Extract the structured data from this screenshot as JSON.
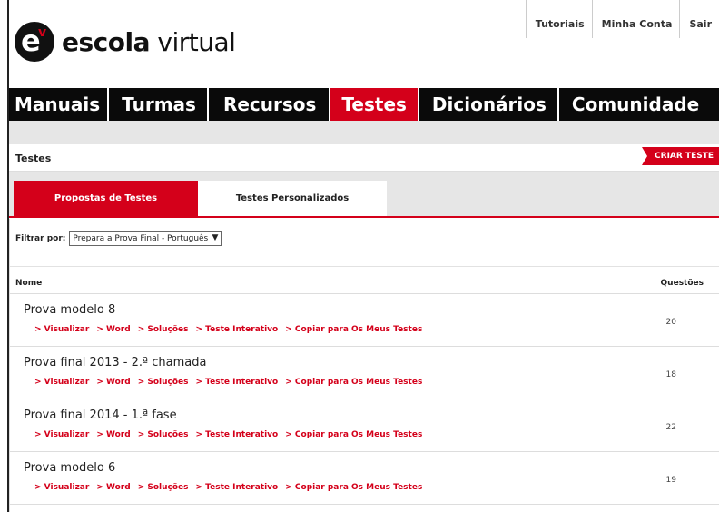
{
  "brand": {
    "logo_text_bold": "escola",
    "logo_text_light": " virtual",
    "badge_letter": "e",
    "badge_mark": "v"
  },
  "toplinks": [
    "Tutoriais",
    "Minha Conta",
    "Sair"
  ],
  "nav": {
    "items": [
      {
        "label": "Manuais",
        "active": false
      },
      {
        "label": "Turmas",
        "active": false
      },
      {
        "label": "Recursos",
        "active": false
      },
      {
        "label": "Testes",
        "active": true
      },
      {
        "label": "Dicionários",
        "active": false
      },
      {
        "label": "Comunidade",
        "active": false
      }
    ]
  },
  "page": {
    "title": "Testes",
    "create_button": "CRIAR TESTE"
  },
  "tabs": [
    {
      "label": "Propostas de Testes",
      "active": true
    },
    {
      "label": "Testes Personalizados",
      "active": false
    }
  ],
  "filter": {
    "label": "Filtrar por:",
    "selected": "Prepara a Prova Final - Português",
    "caret": "▼"
  },
  "table": {
    "headers": {
      "name": "Nome",
      "questions": "Questões"
    },
    "link_labels": [
      "> Visualizar",
      "> Word",
      "> Soluções",
      "> Teste Interativo",
      "> Copiar para Os Meus Testes"
    ],
    "rows": [
      {
        "name": "Prova modelo 8",
        "questions": "20"
      },
      {
        "name": "Prova final 2013 - 2.ª chamada",
        "questions": "18"
      },
      {
        "name": "Prova final 2014 - 1.ª fase",
        "questions": "22"
      },
      {
        "name": "Prova modelo 6",
        "questions": "19"
      }
    ]
  },
  "colors": {
    "accent": "#d4001a",
    "nav_bg": "#0a0a0a",
    "strip": "#e6e6e6"
  }
}
